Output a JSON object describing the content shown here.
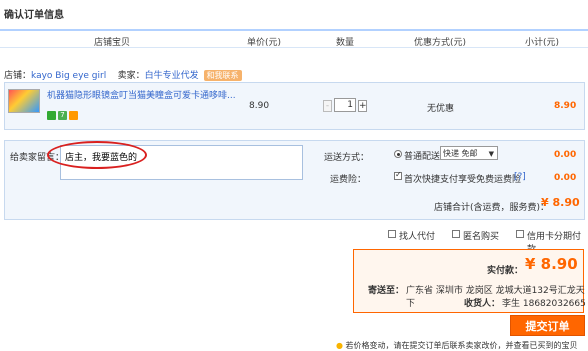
{
  "page_title": "确认订单信息",
  "columns": {
    "shop_item": "店铺宝贝",
    "unit_price": "单价(元)",
    "quantity": "数量",
    "discount": "优惠方式(元)",
    "subtotal": "小计(元)"
  },
  "shop": {
    "label": "店铺：",
    "name": "kayo Big eye girl",
    "seller_label": "卖家：",
    "seller_name": "白牛专业代发",
    "contact_label": "和我联系"
  },
  "item": {
    "name": "机器猫隐形眼镜盒叮当猫美瞳盒可爱卡通哆啡...",
    "price": "8.90",
    "quantity": "1",
    "discount": "无优惠",
    "subtotal": "8.90"
  },
  "message": {
    "label": "给卖家留言：",
    "value": "店主，我要蓝色的"
  },
  "shipping": {
    "label": "运送方式：",
    "option": "普通配送",
    "selected": "快递 免邮",
    "price": "0.00"
  },
  "insurance": {
    "label": "运费险：",
    "text": "首次快捷支付享受免费运费险",
    "help": "[?]",
    "price": "0.00"
  },
  "shop_total": {
    "label": "店铺合计(含运费，服务费)：",
    "value": "¥ 8.90"
  },
  "options": {
    "agent_pay": "找人代付",
    "anonymous": "匿名购买",
    "installment": "信用卡分期付款"
  },
  "summary": {
    "pay_label": "实付款：",
    "pay_value": "¥ 8.90",
    "addr_label": "寄送至：",
    "addr_value": "广东省 深圳市 龙岗区 龙城大道132号汇龙天下",
    "recv_label": "收货人：",
    "recv_value": "李生  18682032665"
  },
  "submit_label": "提交订单",
  "note": "若价格变动，请在提交订单后联系卖家改价，并查看已买到的宝贝"
}
